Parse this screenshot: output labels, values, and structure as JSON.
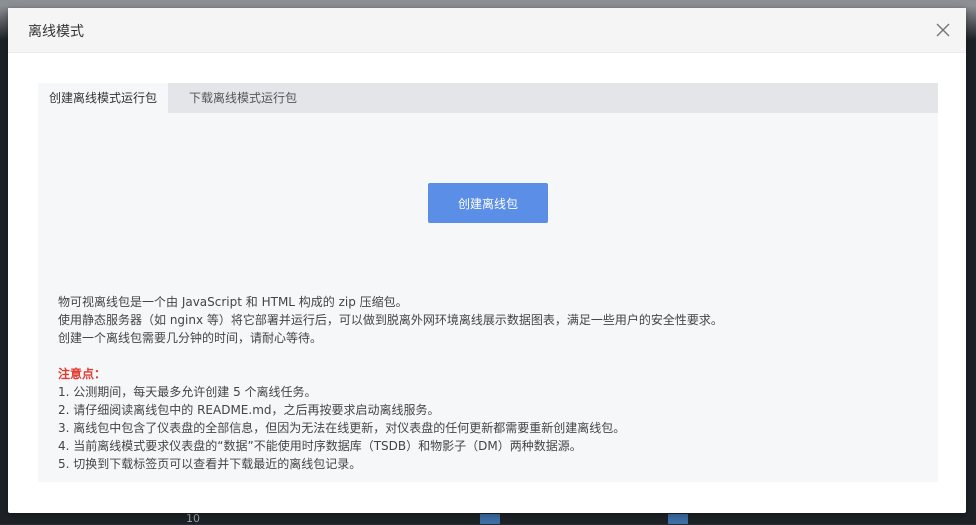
{
  "background": {
    "axis_tick": "10"
  },
  "modal": {
    "title": "离线模式",
    "close_icon": "close-icon"
  },
  "tabs": [
    {
      "label": "创建离线模式运行包",
      "active": true
    },
    {
      "label": "下载离线模式运行包",
      "active": false
    }
  ],
  "create_button": {
    "label": "创建离线包",
    "color": "#5b8ee6"
  },
  "description": [
    "物可视离线包是一个由 JavaScript 和 HTML 构成的 zip 压缩包。",
    "使用静态服务器（如 nginx 等）将它部署并运行后，可以做到脱离外网环境离线展示数据图表，满足一些用户的安全性要求。",
    "创建一个离线包需要几分钟的时间，请耐心等待。"
  ],
  "notes": {
    "title": "注意点：",
    "title_color": "#e03c31",
    "items": [
      "1. 公测期间，每天最多允许创建 5 个离线任务。",
      "2. 请仔细阅读离线包中的 README.md，之后再按要求启动离线服务。",
      "3. 离线包中包含了仪表盘的全部信息，但因为无法在线更新，对仪表盘的任何更新都需要重新创建离线包。",
      "4. 当前离线模式要求仪表盘的“数据”不能使用时序数据库（TSDB）和物影子（DM）两种数据源。",
      "5. 切换到下载标签页可以查看并下载最近的离线包记录。"
    ]
  }
}
